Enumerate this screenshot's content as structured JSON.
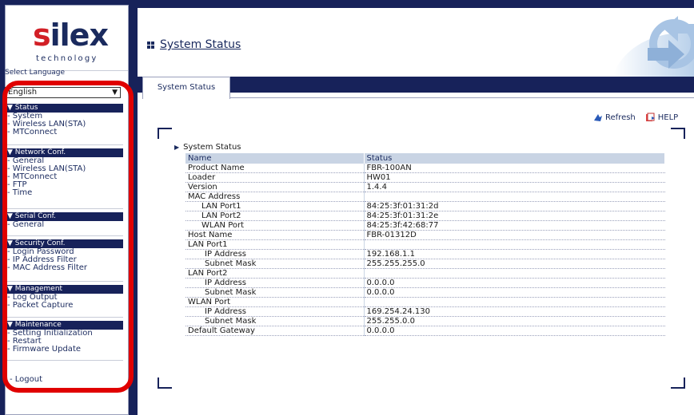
{
  "brand": {
    "logo_main": "silex",
    "logo_sub": "technology"
  },
  "language": {
    "label": "Select Language",
    "selected": "English"
  },
  "menu": [
    {
      "title": "▼ Status",
      "items": [
        "- System",
        "- Wireless LAN(STA)",
        "- MTConnect"
      ]
    },
    {
      "title": "▼ Network Conf.",
      "items": [
        "- General",
        "- Wireless LAN(STA)",
        "- MTConnect",
        "- FTP",
        "- Time"
      ]
    },
    {
      "title": "▼ Serial Conf.",
      "items": [
        "- General"
      ]
    },
    {
      "title": "▼ Security Conf.",
      "items": [
        "- Login Password",
        "- IP Address Filter",
        "- MAC Address Filter"
      ]
    },
    {
      "title": "▼ Management",
      "items": [
        "- Log Output",
        "- Packet Capture"
      ]
    },
    {
      "title": "▼ Maintenance",
      "items": [
        "- Setting Initialization",
        "- Restart",
        "- Firmware Update"
      ]
    }
  ],
  "logout": "- Logout",
  "page": {
    "title": "System Status",
    "tab": "System Status"
  },
  "links": {
    "refresh": "Refresh",
    "help": "HELP"
  },
  "section_title": "System Status",
  "table": {
    "headers": [
      "Name",
      "Status"
    ],
    "rows": [
      {
        "name": "Product Name",
        "value": "FBR-100AN",
        "indent": 0
      },
      {
        "name": "Loader",
        "value": "HW01",
        "indent": 0
      },
      {
        "name": "Version",
        "value": "1.4.4",
        "indent": 0
      },
      {
        "name": "MAC Address",
        "value": "",
        "indent": 0
      },
      {
        "name": "LAN Port1",
        "value": "84:25:3f:01:31:2d",
        "indent": 1
      },
      {
        "name": "LAN Port2",
        "value": "84:25:3f:01:31:2e",
        "indent": 1
      },
      {
        "name": "WLAN Port",
        "value": "84:25:3f:42:68:77",
        "indent": 1
      },
      {
        "name": "Host Name",
        "value": "FBR-01312D",
        "indent": 0
      },
      {
        "name": "LAN Port1",
        "value": "",
        "indent": 0
      },
      {
        "name": "IP Address",
        "value": "192.168.1.1",
        "indent": 2
      },
      {
        "name": "Subnet Mask",
        "value": "255.255.255.0",
        "indent": 2
      },
      {
        "name": "LAN Port2",
        "value": "",
        "indent": 0
      },
      {
        "name": "IP Address",
        "value": "0.0.0.0",
        "indent": 2
      },
      {
        "name": "Subnet Mask",
        "value": "0.0.0.0",
        "indent": 2
      },
      {
        "name": "WLAN Port",
        "value": "",
        "indent": 0
      },
      {
        "name": "IP Address",
        "value": "169.254.24.130",
        "indent": 2
      },
      {
        "name": "Subnet Mask",
        "value": "255.255.0.0",
        "indent": 2
      },
      {
        "name": "Default Gateway",
        "value": "0.0.0.0",
        "indent": 0
      }
    ]
  },
  "colors": {
    "navy": "#17225a",
    "highlight": "#e00000",
    "header_bg": "#c9d4e4",
    "logo_red": "#d21f26"
  },
  "icons": [
    "refresh-icon",
    "help-icon",
    "title-grid-icon",
    "chevron-down-icon"
  ]
}
